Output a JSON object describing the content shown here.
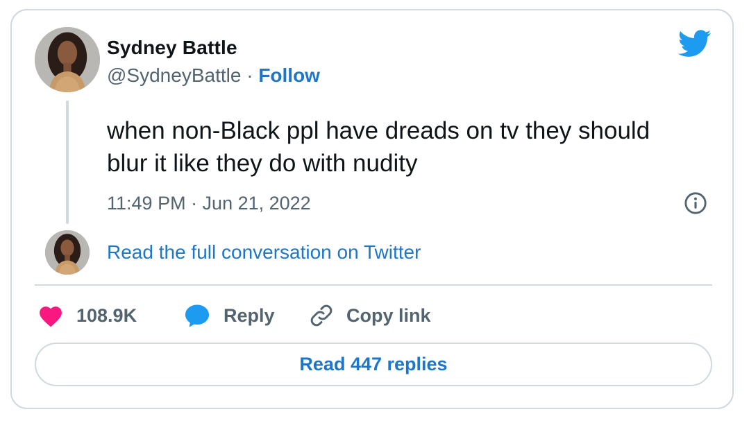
{
  "author": {
    "name": "Sydney Battle",
    "handle": "@SydneyBattle",
    "separator": " · ",
    "follow_label": "Follow"
  },
  "tweet": {
    "text": "when non-Black ppl have dreads on tv they should blur it like they do with nudity",
    "timestamp": "11:49 PM · Jun 21, 2022"
  },
  "conversation_link": "Read the full conversation on Twitter",
  "actions": {
    "like_count": "108.9K",
    "reply_label": "Reply",
    "copy_label": "Copy link"
  },
  "replies_button": "Read 447 replies",
  "icons": {
    "brand": "twitter-bird-icon",
    "like": "heart-icon",
    "reply": "speech-bubble-icon",
    "copy": "link-icon",
    "info": "info-icon"
  },
  "colors": {
    "brand_blue": "#1d9bf0",
    "link_blue": "#1d76c8",
    "like_pink": "#f91880",
    "text_primary": "#0f1419",
    "text_secondary": "#536471",
    "border": "#cfd9de"
  }
}
